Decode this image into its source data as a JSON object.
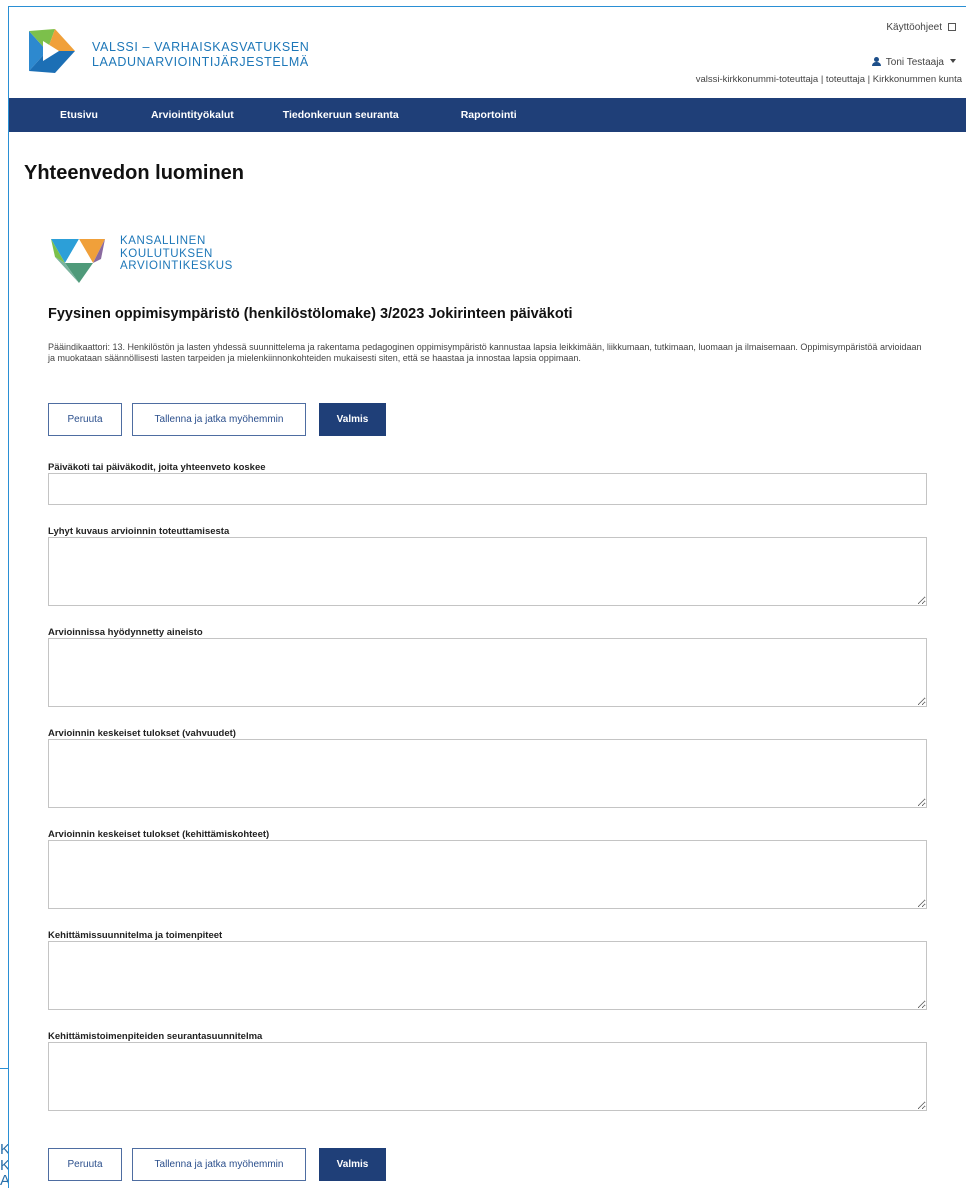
{
  "header": {
    "brand_line1": "VALSSI – VARHAISKASVATUKSEN",
    "brand_line2": "LAADUNARVIOINTIJÄRJESTELMÄ",
    "help_link": "Käyttöohjeet",
    "user_name": "Toni Testaaja",
    "user_org": "valssi-kirkkonummi-toteuttaja | toteuttaja | Kirkkonummen kunta"
  },
  "nav": {
    "items": [
      {
        "label": "Etusivu"
      },
      {
        "label": "Arviointityökalut"
      },
      {
        "label": "Tiedonkeruun seuranta"
      },
      {
        "label": "Raportointi"
      }
    ]
  },
  "page": {
    "title": "Yhteenvedon luominen",
    "karvi_line1": "KANSALLINEN",
    "karvi_line2": "KOULUTUKSEN",
    "karvi_line3": "ARVIOINTIKESKUS",
    "form_title": "Fyysinen oppimisympäristö (henkilöstölomake) 3/2023 Jokirinteen päiväkoti",
    "description": "Pääindikaattori: 13. Henkilöstön ja lasten yhdessä suunnittelema ja rakentama pedagoginen oppimisympäristö kannustaa lapsia leikkimään, liikkumaan, tutkimaan, luomaan ja ilmaisemaan. Oppimisympäristöä arvioidaan ja muokataan säännöllisesti lasten tarpeiden ja mielenkiinnonkohteiden mukaisesti siten, että se haastaa ja innostaa lapsia oppimaan."
  },
  "buttons": {
    "cancel": "Peruuta",
    "save_later": "Tallenna ja jatka myöhemmin",
    "done": "Valmis"
  },
  "fields": [
    {
      "label": "Päiväkoti tai päiväkodit, joita yhteenveto koskee",
      "value": ""
    },
    {
      "label": "Lyhyt kuvaus arvioinnin toteuttamisesta",
      "value": ""
    },
    {
      "label": "Arvioinnissa hyödynnetty aineisto",
      "value": ""
    },
    {
      "label": "Arvioinnin keskeiset tulokset (vahvuudet)",
      "value": ""
    },
    {
      "label": "Arvioinnin keskeiset tulokset (kehittämiskohteet)",
      "value": ""
    },
    {
      "label": "Kehittämissuunnitelma ja toimenpiteet",
      "value": ""
    },
    {
      "label": "Kehittämistoimenpiteiden seurantasuunnitelma",
      "value": ""
    }
  ],
  "background_fragment": {
    "chars": [
      "K",
      "K",
      "A"
    ]
  }
}
